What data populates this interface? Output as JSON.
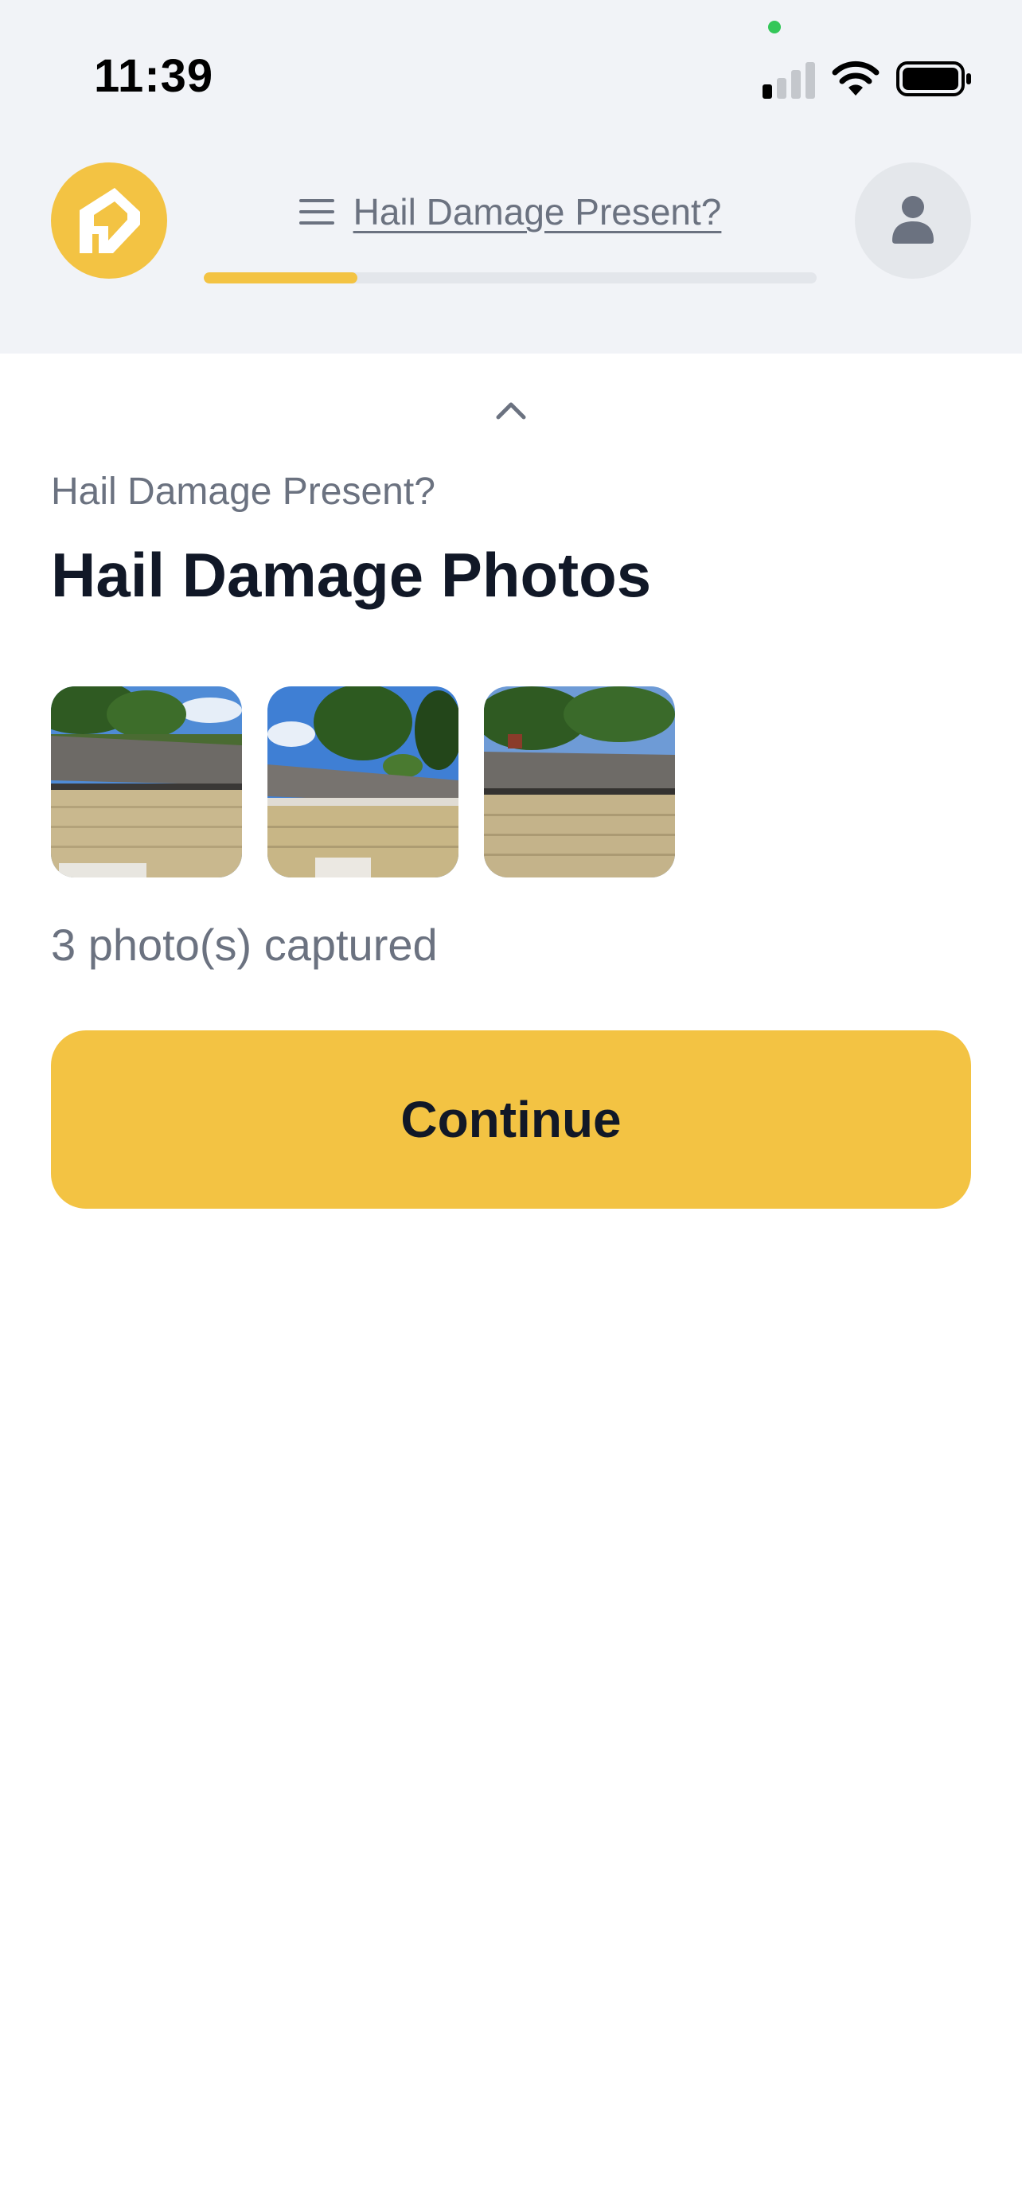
{
  "status_bar": {
    "time": "11:39",
    "signal_bars_active": 1,
    "signal_bars_total": 4,
    "privacy_dot_color": "#34c759",
    "wifi_icon": "wifi-icon",
    "battery_icon": "battery-icon"
  },
  "header": {
    "logo_icon": "house-logo-icon",
    "menu_icon": "menu-icon",
    "title": "Hail Damage Present?",
    "progress": 0.25,
    "avatar_icon": "user-icon"
  },
  "content": {
    "collapse_icon": "chevron-up-icon",
    "step_label": "Hail Damage Present?",
    "title": "Hail Damage Photos",
    "photos": [
      {
        "subject": "roof edge and siding with trees"
      },
      {
        "subject": "roof corner with tall tree"
      },
      {
        "subject": "roof gutter line with trees"
      }
    ],
    "photo_count_text": "3 photo(s) captured",
    "continue_label": "Continue"
  },
  "colors": {
    "accent": "#f3c343",
    "header_background": "#f1f3f7",
    "muted_text": "#6b7280",
    "heading_text": "#111827",
    "progress_track": "#e3e6eb",
    "avatar_background": "#e4e7eb"
  }
}
